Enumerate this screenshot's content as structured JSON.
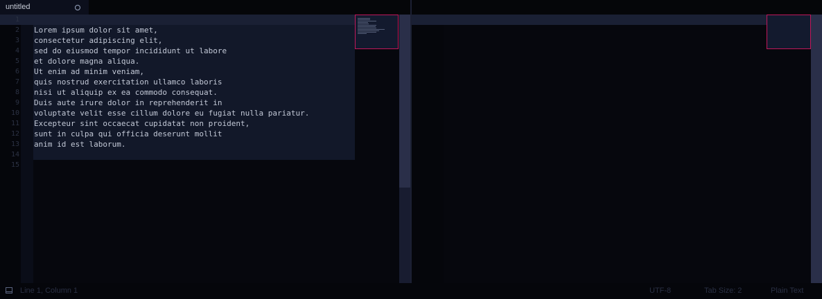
{
  "tab": {
    "title": "untitled"
  },
  "editor": {
    "line_numbers": [
      "1",
      "2",
      "3",
      "4",
      "5",
      "6",
      "7",
      "8",
      "9",
      "10",
      "11",
      "12",
      "13",
      "14",
      "15"
    ],
    "lines": [
      "Lorem ipsum dolor sit amet,",
      "consectetur adipiscing elit,",
      "sed do eiusmod tempor incididunt ut labore",
      "et dolore magna aliqua.",
      "Ut enim ad minim veniam,",
      "quis nostrud exercitation ullamco laboris",
      "nisi ut aliquip ex ea commodo consequat.",
      "Duis aute irure dolor in reprehenderit in",
      "voluptate velit esse cillum dolore eu fugiat nulla pariatur.",
      "Excepteur sint occaecat cupidatat non proident,",
      "sunt in culpa qui officia deserunt mollit",
      "anim id est laborum."
    ]
  },
  "statusbar": {
    "position": "Line 1, Column 1",
    "encoding": "UTF-8",
    "tab_size": "Tab Size: 2",
    "syntax": "Plain Text"
  },
  "colors": {
    "background": "#06070d",
    "selection": "#121829",
    "minimap_border": "#c2185b",
    "text": "#c2c8d6"
  }
}
